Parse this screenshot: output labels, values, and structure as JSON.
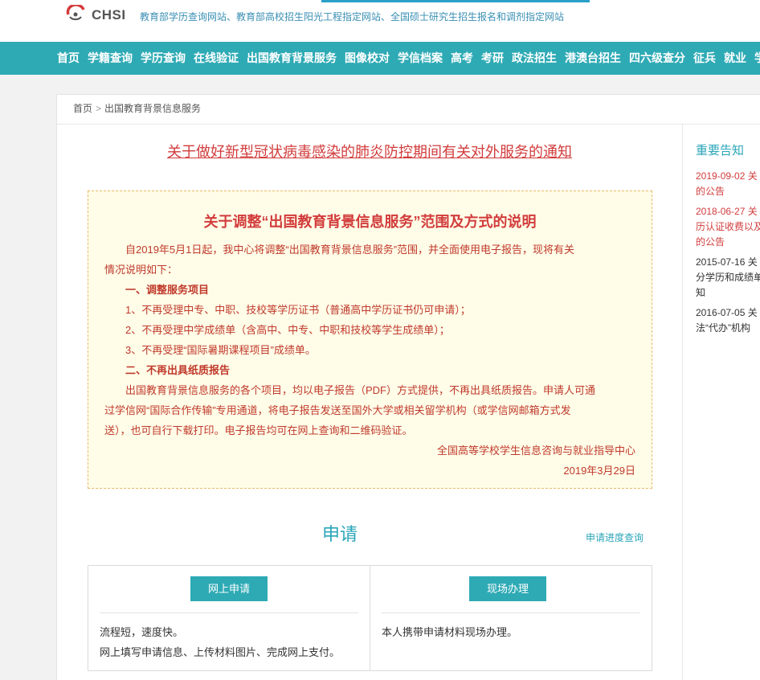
{
  "header": {
    "logo_text": "CHSI",
    "tagline": "教育部学历查询网站、教育部高校招生阳光工程指定网站、全国硕士研究生招生报名和调剂指定网站"
  },
  "nav": {
    "items": [
      "首页",
      "学籍查询",
      "学历查询",
      "在线验证",
      "出国教育背景服务",
      "图像校对",
      "学信档案",
      "高考",
      "考研",
      "政法招生",
      "港澳台招生",
      "四六级查分",
      "征兵",
      "就业",
      "学"
    ]
  },
  "breadcrumb": {
    "home": "首页",
    "separator": ">",
    "current": "出国教育背景信息服务"
  },
  "notice": {
    "link_text": "关于做好新型冠状病毒感染的肺炎防控期间有关对外服务的通知"
  },
  "infobox": {
    "title": "关于调整“出国教育背景信息服务”范围及方式的说明",
    "intro_1": "自2019年5月1日起，我中心将调整“出国教育背景信息服务”范围，并全面使用电子报告，现将有关",
    "intro_2": "情况说明如下：",
    "section1_title": "一、调整服务项目",
    "item1": "1、不再受理中专、中职、技校等学历证书（普通高中学历证书仍可申请）；",
    "item2": "2、不再受理中学成绩单（含高中、中专、中职和技校等学生成绩单）；",
    "item3": "3、不再受理“国际暑期课程项目”成绩单。",
    "section2_title": "二、不再出具纸质报告",
    "body_1": "出国教育背景信息服务的各个项目，均以电子报告（PDF）方式提供，不再出具纸质报告。申请人可通",
    "body_2": "过学信网“国际合作传输”专用通道，将电子报告发送至国外大学或相关留学机构（或学信网邮箱方式发",
    "body_3": "送），也可自行下载打印。电子报告均可在网上查询和二维码验证。",
    "signature": "全国高等学校学生信息咨询与就业指导中心",
    "date": "2019年3月29日"
  },
  "apply": {
    "title": "申请",
    "progress_link": "申请进度查询",
    "online": {
      "button": "网上申请",
      "line1": "流程短，速度快。",
      "line2": "网上填写申请信息、上传材料图片、完成网上支付。"
    },
    "onsite": {
      "button": "现场办理",
      "line1": "本人携带申请材料现场办理。"
    }
  },
  "sidebar": {
    "title": "重要告知",
    "items": [
      {
        "line1": "2019-09-02 关",
        "line2": "的公告"
      },
      {
        "line1": "2018-06-27 关",
        "line2": "历认证收费以及",
        "line3": "的公告"
      },
      {
        "line1": "2015-07-16 关",
        "line2": "分学历和成绩单",
        "line3": "知"
      },
      {
        "line1": "2016-07-05 关",
        "line2": "法“代办”机构"
      }
    ]
  },
  "colors": {
    "brand_teal": "#2eaab5",
    "notice_red": "#d23c3c",
    "infobox_bg": "#fffde8"
  }
}
